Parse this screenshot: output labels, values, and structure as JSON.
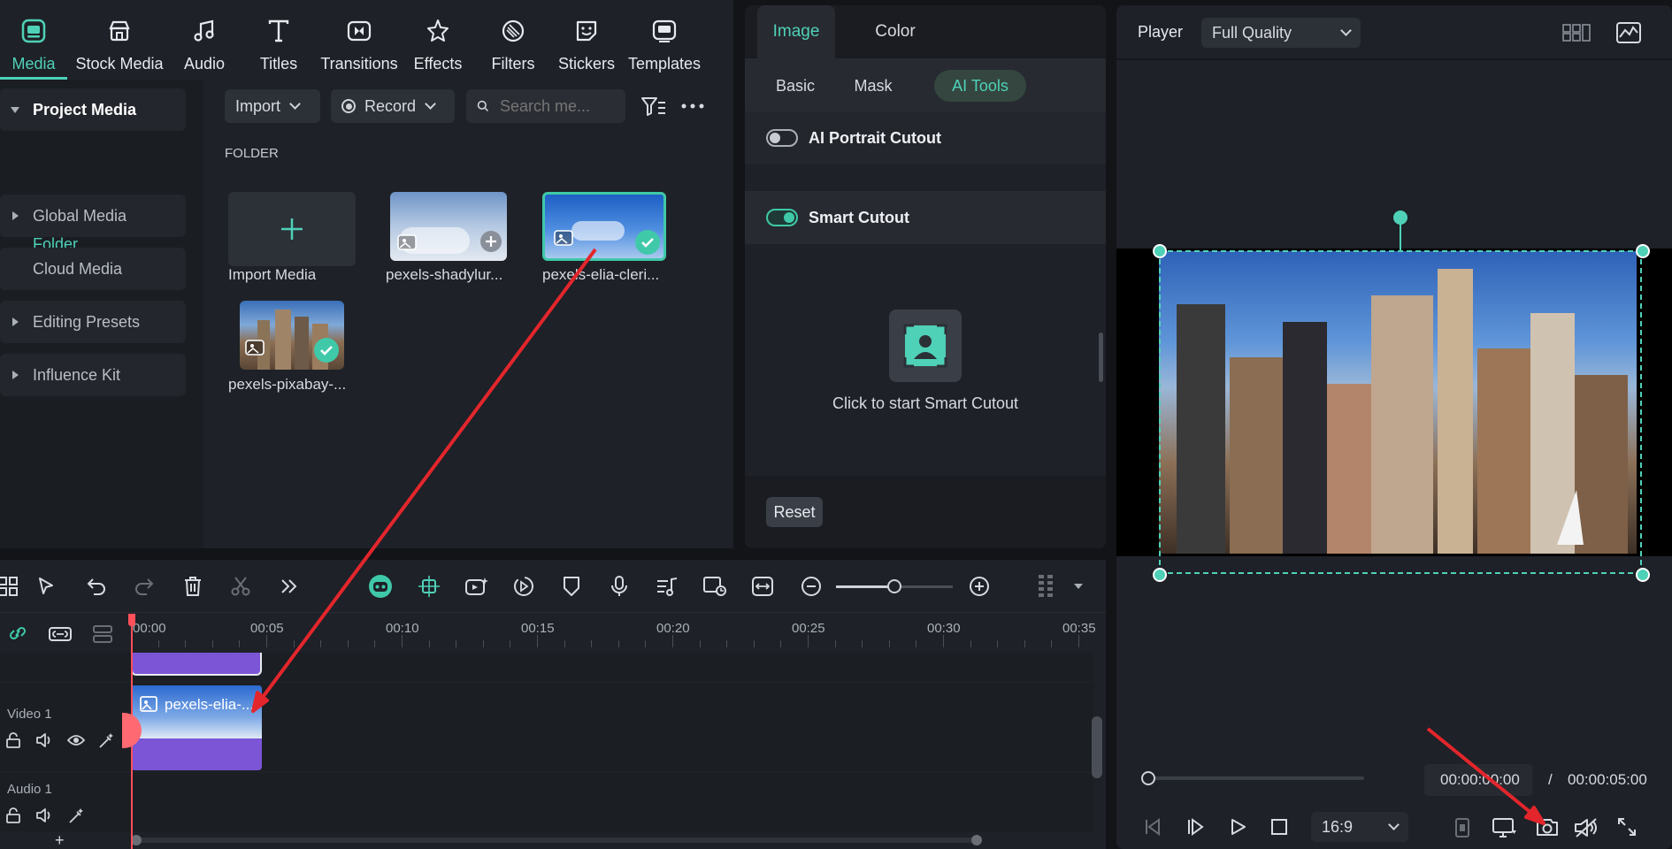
{
  "toolbar": {
    "items": [
      {
        "label": "Media",
        "icon": "media-icon",
        "active": true
      },
      {
        "label": "Stock Media",
        "icon": "stock-media-icon"
      },
      {
        "label": "Audio",
        "icon": "music-note-icon"
      },
      {
        "label": "Titles",
        "icon": "titles-t-icon"
      },
      {
        "label": "Transitions",
        "icon": "transitions-icon"
      },
      {
        "label": "Effects",
        "icon": "effects-icon"
      },
      {
        "label": "Filters",
        "icon": "filters-icon"
      },
      {
        "label": "Stickers",
        "icon": "stickers-icon"
      },
      {
        "label": "Templates",
        "icon": "templates-icon"
      }
    ]
  },
  "sidebar": {
    "items": [
      {
        "label": "Project Media"
      },
      {
        "label": "Global Media"
      },
      {
        "label": "Cloud Media"
      },
      {
        "label": "Editing Presets"
      },
      {
        "label": "Influence Kit"
      }
    ],
    "folder": "Folder"
  },
  "media": {
    "import_label": "Import",
    "record_label": "Record",
    "search_placeholder": "Search me...",
    "section_title": "FOLDER",
    "import_media_label": "Import Media",
    "items": [
      {
        "label": "pexels-shadylur..."
      },
      {
        "label": "pexels-elia-cleri..."
      },
      {
        "label": "pexels-pixabay-..."
      }
    ]
  },
  "properties": {
    "tabs": [
      "Image",
      "Color"
    ],
    "subtabs": [
      "Basic",
      "Mask",
      "AI Tools"
    ],
    "ai_portrait": "AI Portrait Cutout",
    "smart_cutout": "Smart Cutout",
    "smart_cutout_hint": "Click to start Smart Cutout",
    "reset_label": "Reset"
  },
  "player": {
    "title": "Player",
    "quality": "Full Quality",
    "current_time": "00:00:00:00",
    "separator": "/",
    "total_time": "00:00:05:00",
    "aspect": "16:9",
    "progress": 0
  },
  "timeline": {
    "ticks": [
      "00:00",
      "00:05",
      "00:10",
      "00:15",
      "00:20",
      "00:25",
      "00:30",
      "00:35"
    ],
    "tracks": [
      {
        "label": "Video 1"
      },
      {
        "label": "Audio 1"
      }
    ],
    "clip_label": "pexels-elia-...",
    "add_track": "+"
  },
  "colors": {
    "accent": "#4fd1b8",
    "clip": "#7b55d6",
    "playhead": "#ff4f5a",
    "arrow": "#e3262c"
  }
}
